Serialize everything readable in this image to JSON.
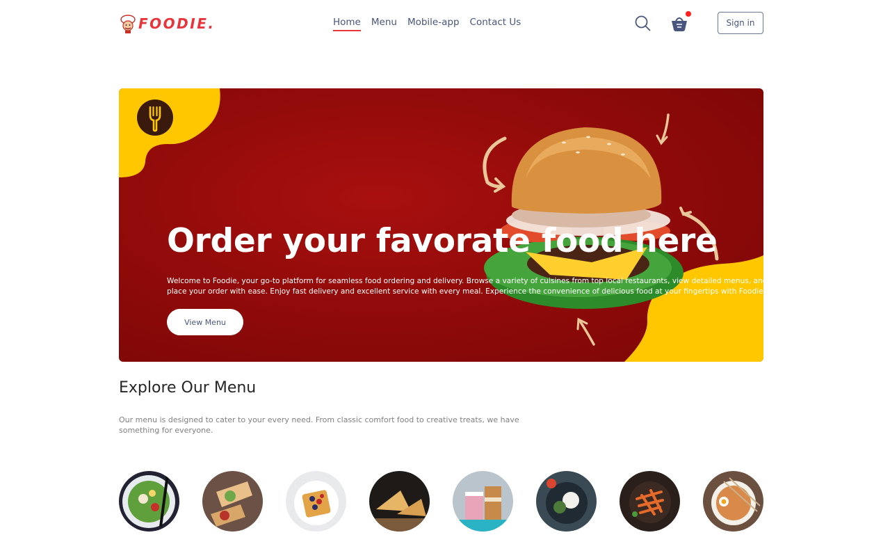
{
  "brand": {
    "name": "FOODIE.",
    "accent": "#e8343b"
  },
  "nav": {
    "items": [
      {
        "label": "Home",
        "active": true
      },
      {
        "label": "Menu",
        "active": false
      },
      {
        "label": "Mobile-app",
        "active": false
      },
      {
        "label": "Contact Us",
        "active": false
      }
    ],
    "signin_label": "Sign in",
    "icons": [
      "search-icon",
      "basket-icon"
    ]
  },
  "hero": {
    "title": "Order your favorate food here",
    "description": "Welcome to Foodie, your go-to platform for seamless food ordering and delivery. Browse a variety of cuisines from top local restaurants, view detailed menus, and place your order with ease. Enjoy fast delivery and excellent service with every meal. Experience the convenience of delicious food at your fingertips with Foodie.",
    "button_label": "View Menu",
    "colors": {
      "background": "#930b0a",
      "blob": "#ffc700"
    }
  },
  "explore": {
    "title": "Explore Our Menu",
    "text": "Our menu is designed to cater to your every need. From classic comfort food to creative treats, we have something for everyone.",
    "items": [
      {
        "icon": "salad-image"
      },
      {
        "icon": "rolls-image"
      },
      {
        "icon": "desserts-image"
      },
      {
        "icon": "sandwich-image"
      },
      {
        "icon": "cake-image"
      },
      {
        "icon": "pure-veg-image"
      },
      {
        "icon": "pasta-image"
      },
      {
        "icon": "noodles-image"
      }
    ]
  }
}
